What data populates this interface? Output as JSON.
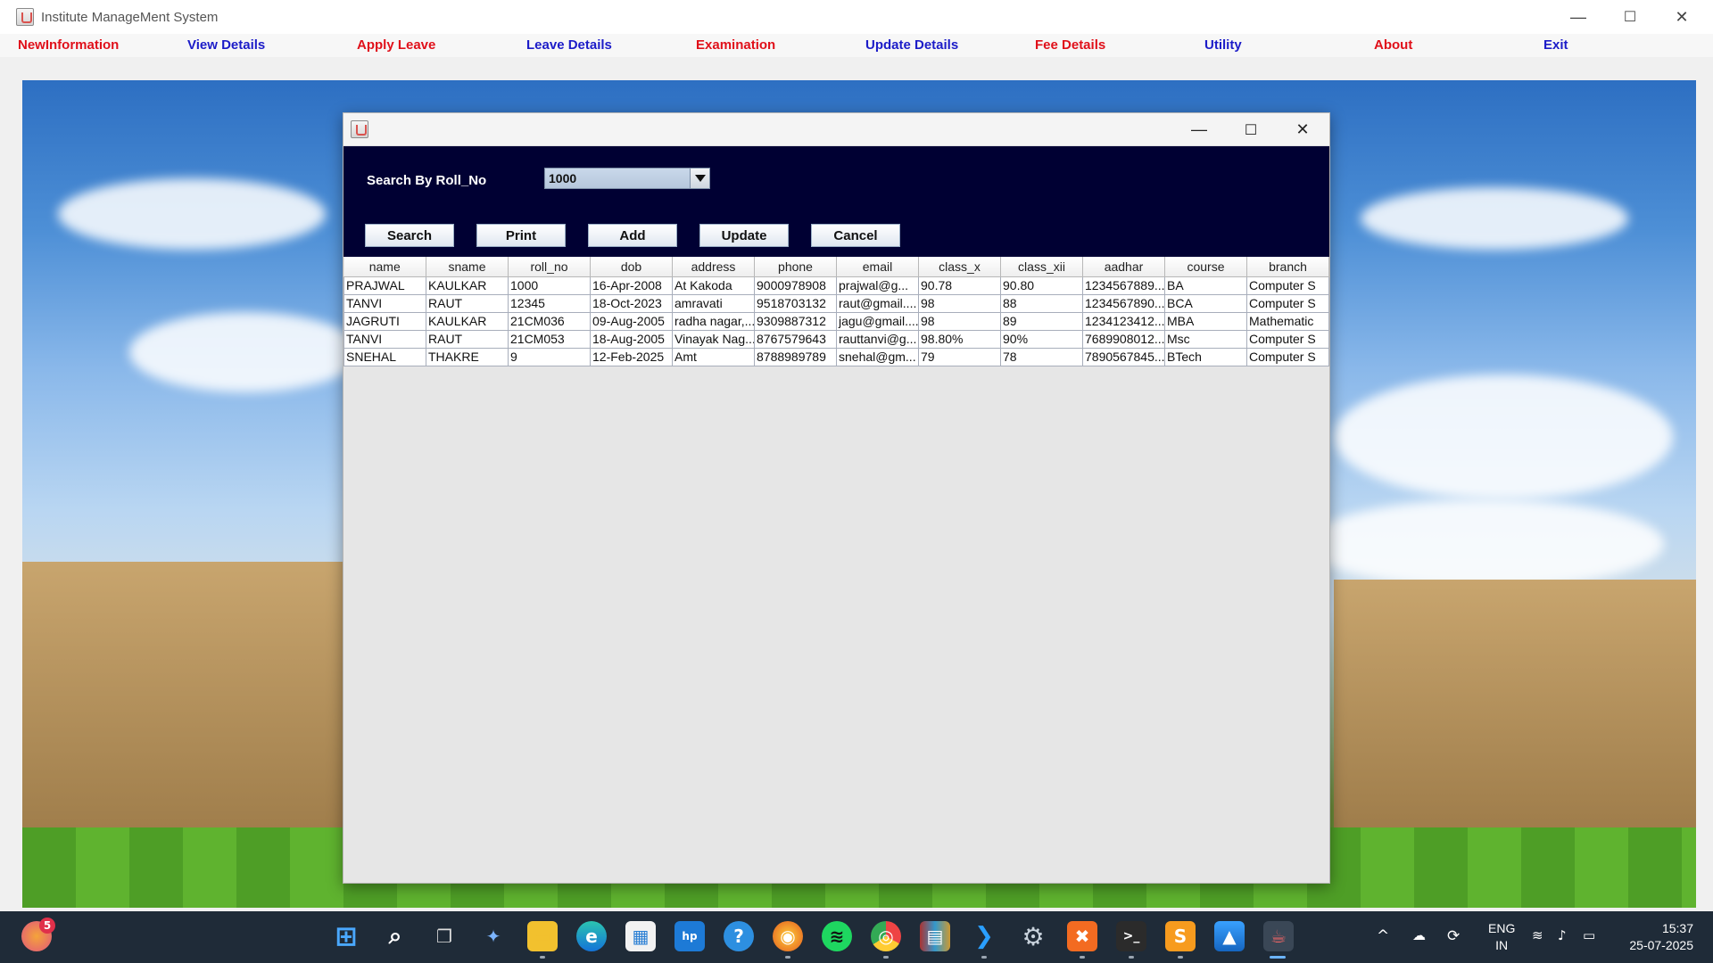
{
  "window": {
    "title": "Institute ManageMent System",
    "controls": {
      "minimize": "—",
      "maximize": "☐",
      "close": "✕"
    }
  },
  "menu": [
    {
      "label": "NewInformation",
      "color": "#e0101a"
    },
    {
      "label": "View Details",
      "color": "#1c1cc8"
    },
    {
      "label": "Apply Leave",
      "color": "#e0101a"
    },
    {
      "label": "Leave Details",
      "color": "#1c1cc8"
    },
    {
      "label": "Examination",
      "color": "#e0101a"
    },
    {
      "label": "Update Details",
      "color": "#1c1cc8"
    },
    {
      "label": "Fee Details",
      "color": "#e0101a"
    },
    {
      "label": "Utility",
      "color": "#1c1cc8"
    },
    {
      "label": "About",
      "color": "#e0101a"
    },
    {
      "label": "Exit",
      "color": "#1c1cc8"
    }
  ],
  "dialog": {
    "controls": {
      "minimize": "—",
      "maximize": "☐",
      "close": "✕"
    },
    "search_label": "Search By Roll_No",
    "combo_value": "1000",
    "buttons": {
      "search": "Search",
      "print": "Print",
      "add": "Add",
      "update": "Update",
      "cancel": "Cancel"
    },
    "panel_color": "#000033"
  },
  "table": {
    "columns": [
      "name",
      "sname",
      "roll_no",
      "dob",
      "address",
      "phone",
      "email",
      "class_x",
      "class_xii",
      "aadhar",
      "course",
      "branch"
    ],
    "rows": [
      [
        "PRAJWAL",
        "KAULKAR",
        "1000",
        "16-Apr-2008",
        "At Kakoda",
        "9000978908",
        "prajwal@g...",
        "90.78",
        "90.80",
        "1234567889...",
        "BA",
        "Computer S"
      ],
      [
        "TANVI",
        "RAUT",
        "12345",
        "18-Oct-2023",
        "amravati",
        "9518703132",
        "raut@gmail....",
        "98",
        "88",
        "1234567890...",
        "BCA",
        "Computer S"
      ],
      [
        "JAGRUTI",
        "KAULKAR",
        "21CM036",
        "09-Aug-2005",
        "radha nagar,...",
        "9309887312",
        "jagu@gmail....",
        "98",
        "89",
        "1234123412...",
        "MBA",
        "Mathematic"
      ],
      [
        "TANVI",
        "RAUT",
        "21CM053",
        "18-Aug-2005",
        "Vinayak Nag...",
        "8767579643",
        "rauttanvi@g...",
        "98.80%",
        "90%",
        "7689908012...",
        "Msc",
        "Computer S"
      ],
      [
        "SNEHAL",
        "THAKRE",
        "9",
        "12-Feb-2025",
        "Amt",
        "8788989789",
        "snehal@gm...",
        "79",
        "78",
        "7890567845...",
        "BTech",
        "Computer S"
      ]
    ]
  },
  "taskbar": {
    "apps": [
      {
        "name": "copilot-badge-icon",
        "glyph": "●",
        "badge": "5"
      },
      {
        "name": "windows-start-icon",
        "glyph": "⊞"
      },
      {
        "name": "search-icon",
        "glyph": "⌕"
      },
      {
        "name": "task-view-icon",
        "glyph": "❐"
      },
      {
        "name": "copilot-icon",
        "glyph": "✦"
      },
      {
        "name": "file-explorer-icon",
        "glyph": "▭"
      },
      {
        "name": "edge-icon",
        "glyph": "e"
      },
      {
        "name": "store-icon",
        "glyph": "▦"
      },
      {
        "name": "myhp-icon",
        "glyph": "hp"
      },
      {
        "name": "help-icon",
        "glyph": "?"
      },
      {
        "name": "firefox-icon",
        "glyph": "◉"
      },
      {
        "name": "spotify-icon",
        "glyph": "≋"
      },
      {
        "name": "chrome-icon",
        "glyph": "◎"
      },
      {
        "name": "winrar-icon",
        "glyph": "▤"
      },
      {
        "name": "vscode-icon",
        "glyph": "❯"
      },
      {
        "name": "settings-icon",
        "glyph": "⚙"
      },
      {
        "name": "xampp-icon",
        "glyph": "✖"
      },
      {
        "name": "terminal-icon",
        "glyph": ">_"
      },
      {
        "name": "sublime-icon",
        "glyph": "S"
      },
      {
        "name": "photos-icon",
        "glyph": "▲"
      },
      {
        "name": "java-icon",
        "glyph": "☕"
      }
    ],
    "tray": {
      "chevron": "^",
      "lang_top": "ENG",
      "lang_bottom": "IN",
      "time": "15:37",
      "date": "25-07-2025"
    }
  }
}
